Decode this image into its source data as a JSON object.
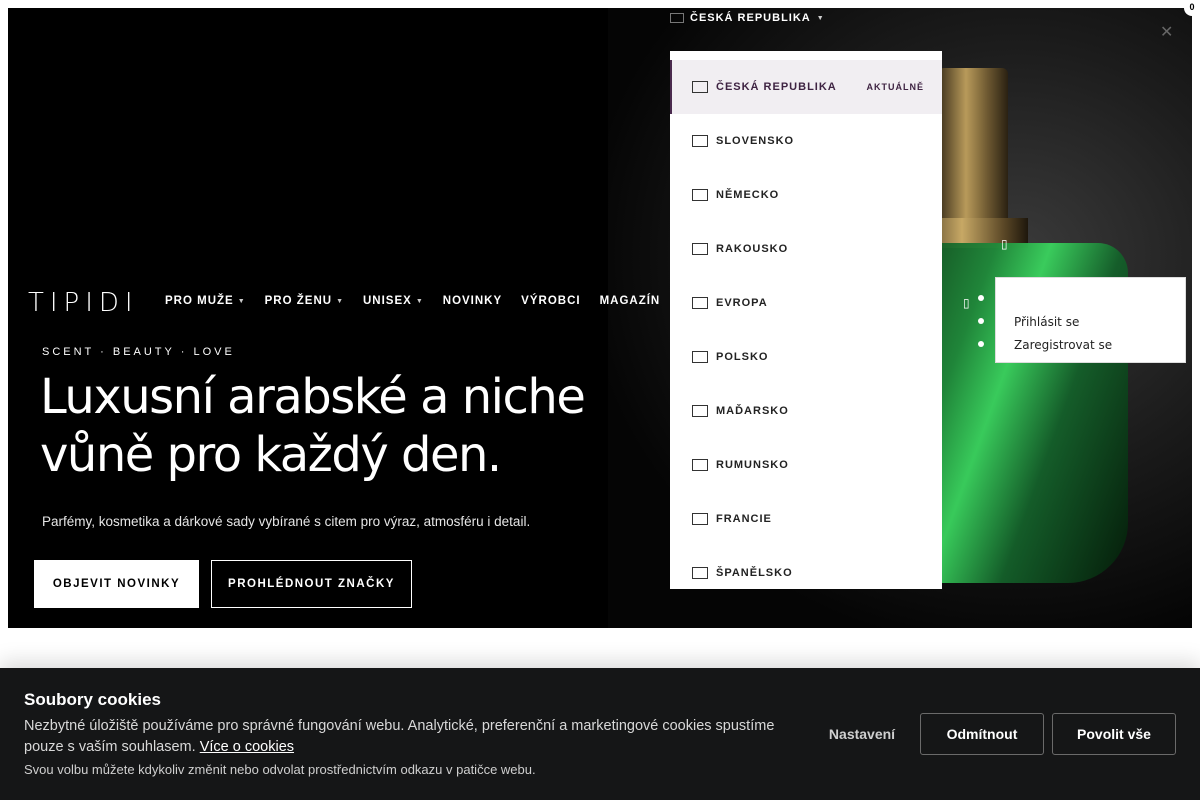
{
  "header": {
    "logo": "TIPIDI",
    "nav": [
      {
        "label": "PRO MUŽE",
        "has_dropdown": true
      },
      {
        "label": "PRO ŽENU",
        "has_dropdown": true
      },
      {
        "label": "UNISEX",
        "has_dropdown": true
      },
      {
        "label": "NOVINKY",
        "has_dropdown": false
      },
      {
        "label": "VÝROBCI",
        "has_dropdown": false
      },
      {
        "label": "MAGAZÍN",
        "has_dropdown": false
      }
    ],
    "country_toggle": "ČESKÁ REPUBLIKA",
    "badge_count": "0"
  },
  "hero": {
    "tagline": "SCENT · BEAUTY · LOVE",
    "headline_line1": "Luxusní arabské a niche",
    "headline_line2": "vůně pro každý den.",
    "subtext": "Parfémy, kosmetika a dárkové sady vybírané s citem pro výraz, atmosféru i detail.",
    "primary_cta": "OBJEVIT NOVINKY",
    "secondary_cta": "PROHLÉDNOUT ZNAČKY"
  },
  "country_menu": {
    "current_label": "AKTUÁLNĚ",
    "items": [
      {
        "label": "ČESKÁ REPUBLIKA",
        "current": true
      },
      {
        "label": "SLOVENSKO"
      },
      {
        "label": "NĚMECKO"
      },
      {
        "label": "RAKOUSKO"
      },
      {
        "label": "EVROPA"
      },
      {
        "label": "POLSKO"
      },
      {
        "label": "MAĎARSKO"
      },
      {
        "label": "RUMUNSKO"
      },
      {
        "label": "FRANCIE"
      },
      {
        "label": "ŠPANĚLSKO"
      }
    ]
  },
  "account_menu": {
    "login": "Přihlásit se",
    "register": "Zaregistrovat se"
  },
  "cookie_banner": {
    "title": "Soubory cookies",
    "text": "Nezbytné úložiště používáme pro správné fungování webu. Analytické, preferenční a marketingové cookies spustíme pouze s vaším souhlasem.",
    "link": "Více o cookies",
    "note": "Svou volbu můžete kdykoliv změnit nebo odvolat prostřednictvím odkazu v patičce webu.",
    "settings": "Nastavení",
    "reject": "Odmítnout",
    "accept": "Povolit vše"
  },
  "colors": {
    "hero_background": "#000000",
    "accent_current": "#4a2a4e",
    "cookie_background": "#151617"
  },
  "icons": [
    "flag-icon",
    "chevron-down-icon",
    "close-icon",
    "user-icon",
    "cart-icon"
  ]
}
